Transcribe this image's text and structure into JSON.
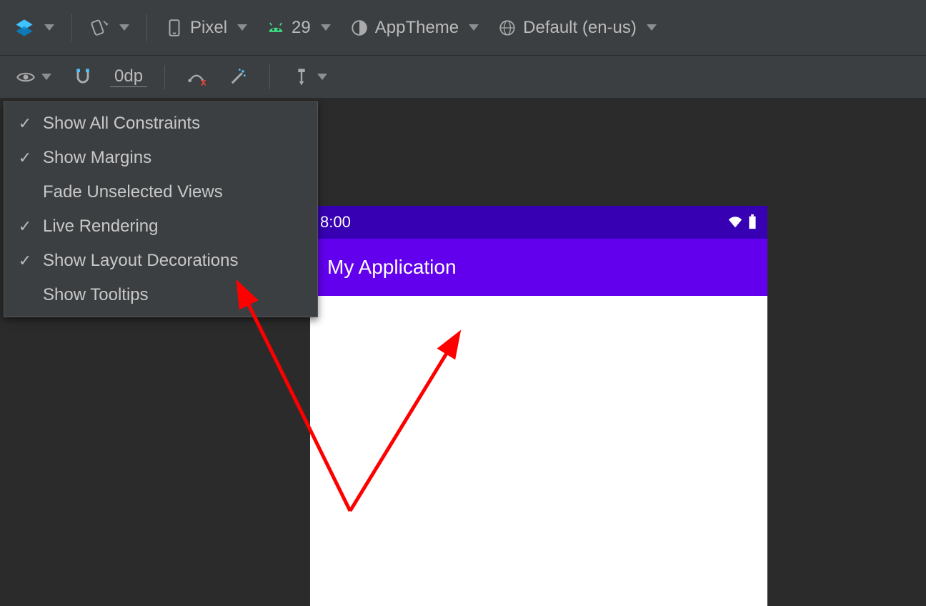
{
  "topToolbar": {
    "device": "Pixel",
    "api": "29",
    "theme": "AppTheme",
    "locale": "Default (en-us)"
  },
  "secondToolbar": {
    "dpValue": "0dp"
  },
  "menu": {
    "items": [
      {
        "label": "Show All Constraints",
        "checked": true
      },
      {
        "label": "Show Margins",
        "checked": true
      },
      {
        "label": "Fade Unselected Views",
        "checked": false
      },
      {
        "label": "Live Rendering",
        "checked": true
      },
      {
        "label": "Show Layout Decorations",
        "checked": true
      },
      {
        "label": "Show Tooltips",
        "checked": false
      }
    ]
  },
  "preview": {
    "statusTime": "8:00",
    "appTitle": "My Application"
  }
}
